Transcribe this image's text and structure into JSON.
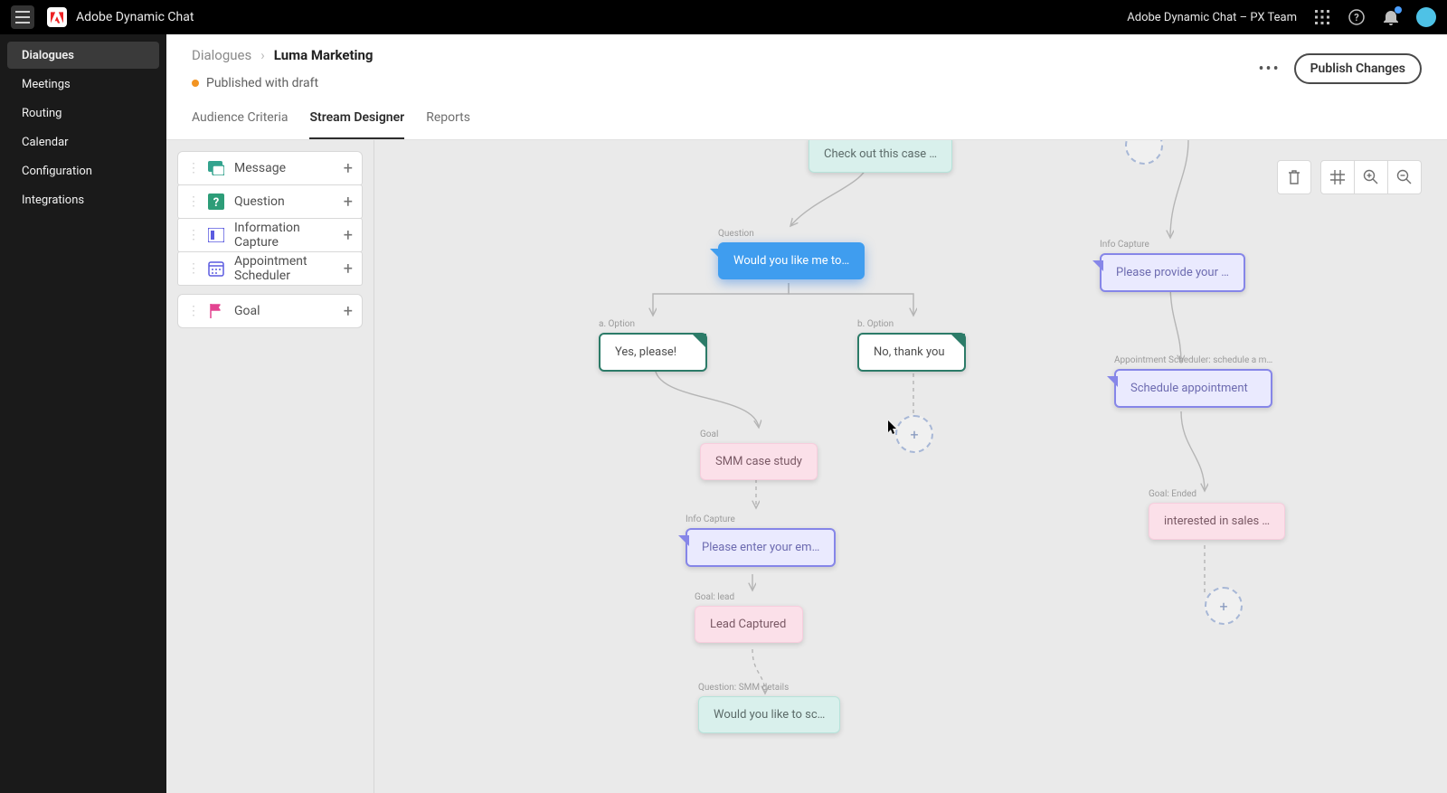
{
  "topbar": {
    "app_name": "Adobe Dynamic Chat",
    "team_label": "Adobe Dynamic Chat – PX Team"
  },
  "sidenav": {
    "items": [
      {
        "label": "Dialogues",
        "active": true
      },
      {
        "label": "Meetings"
      },
      {
        "label": "Routing"
      },
      {
        "label": "Calendar"
      },
      {
        "label": "Configuration"
      },
      {
        "label": "Integrations"
      }
    ]
  },
  "header": {
    "breadcrumb_root": "Dialogues",
    "breadcrumb_current": "Luma Marketing",
    "status_text": "Published with draft",
    "publish_label": "Publish Changes",
    "tabs": [
      {
        "label": "Audience Criteria"
      },
      {
        "label": "Stream Designer",
        "active": true
      },
      {
        "label": "Reports"
      }
    ]
  },
  "palette": {
    "items": [
      {
        "key": "message",
        "label": "Message",
        "color": "#33a38e"
      },
      {
        "key": "question",
        "label": "Question",
        "color": "#2d9d78"
      },
      {
        "key": "info",
        "label": "Information Capture",
        "color": "#5c5ce0"
      },
      {
        "key": "appt",
        "label": "Appointment Scheduler",
        "color": "#5c5ce0"
      },
      {
        "key": "goal",
        "label": "Goal",
        "color": "#e34491"
      }
    ]
  },
  "nodes": {
    "msg_case": {
      "type": "message",
      "label": "",
      "text": "Check out this case …"
    },
    "question_like": {
      "type": "question",
      "label": "Question",
      "text": "Would you like me to…"
    },
    "opt_yes": {
      "type": "option",
      "label": "a. Option",
      "text": "Yes, please!"
    },
    "opt_no": {
      "type": "option",
      "label": "b. Option",
      "text": "No, thank you"
    },
    "goal_smm": {
      "type": "goal",
      "label": "Goal",
      "text": "SMM case study"
    },
    "info_email": {
      "type": "info",
      "label": "Info Capture",
      "text": "Please enter your em…"
    },
    "goal_lead": {
      "type": "goal",
      "label": "Goal: lead",
      "text": "Lead Captured"
    },
    "q_smm": {
      "type": "message",
      "label": "Question: SMM details",
      "text": "Would you like to sc…"
    },
    "info_provide": {
      "type": "info",
      "label": "Info Capture",
      "text": "Please provide your …"
    },
    "appt_sched": {
      "type": "info",
      "label": "Appointment Scheduler: schedule a m…",
      "text": "Schedule appointment"
    },
    "goal_interest": {
      "type": "goal",
      "label": "Goal: Ended",
      "text": "interested in sales …"
    }
  }
}
